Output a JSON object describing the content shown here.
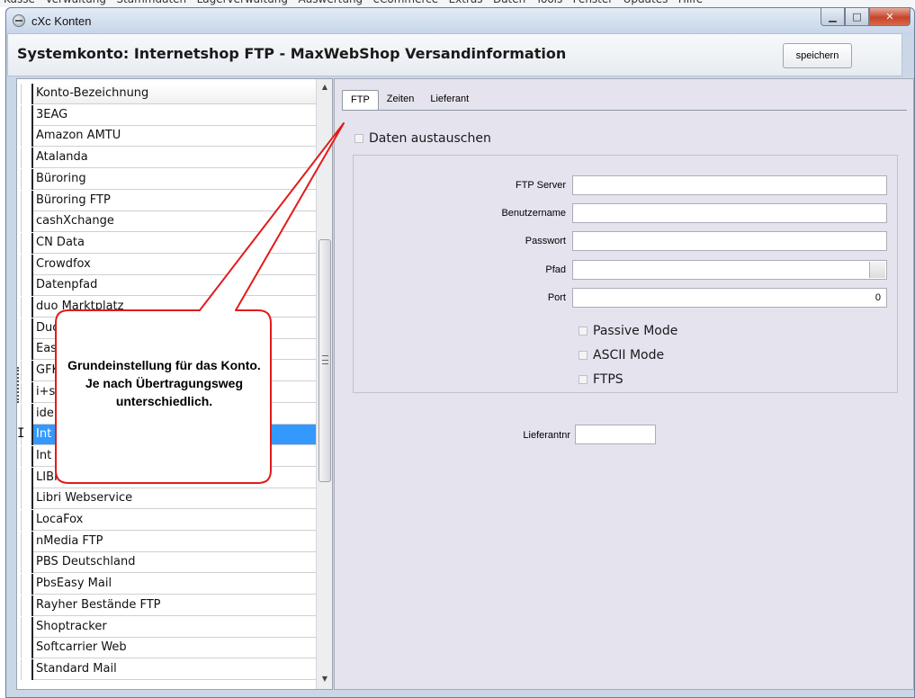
{
  "window": {
    "title": "cXc Konten",
    "minimize_glyph": "▁",
    "maximize_glyph": "□",
    "close_glyph": "✕"
  },
  "header": {
    "title": "Systemkonto: Internetshop FTP - MaxWebShop Versandinformation",
    "save_label": "speichern"
  },
  "list": {
    "column_header": "Konto-Bezeichnung",
    "selected_index": 15,
    "items": [
      "3EAG",
      "Amazon AMTU",
      "Atalanda",
      "Büroring",
      "Büroring FTP",
      "cashXchange",
      "CN Data",
      "Crowdfox",
      "Datenpfad",
      "duo Marktplatz",
      "Duo",
      "Eas",
      "GFK",
      "i+s",
      "ide",
      "Int",
      "Int",
      "LIBRI FTP",
      "Libri Webservice",
      "LocaFox",
      "nMedia FTP",
      "PBS Deutschland",
      "PbsEasy Mail",
      "Rayher Bestände FTP",
      "Shoptracker",
      "Softcarrier Web",
      "Standard Mail"
    ]
  },
  "tabs": [
    "FTP",
    "Zeiten",
    "Lieferant"
  ],
  "active_tab": "FTP",
  "exchange": {
    "label": "Daten austauschen",
    "checked": false
  },
  "ftp": {
    "server_label": "FTP Server",
    "server_value": "",
    "user_label": "Benutzername",
    "user_value": "",
    "password_label": "Passwort",
    "password_value": "",
    "path_label": "Pfad",
    "path_value": "",
    "port_label": "Port",
    "port_value": "0",
    "passive_label": "Passive Mode",
    "ascii_label": "ASCII Mode",
    "ftps_label": "FTPS"
  },
  "supplier": {
    "label": "Lieferantnr",
    "value": ""
  },
  "callout": {
    "text": "Grundeinstellung für das Konto. Je nach Übertragungsweg unterschiedlich."
  },
  "colors": {
    "selection": "#3399ff",
    "callout_border": "#e21b1b",
    "panel_background": "#e4e3ee"
  }
}
